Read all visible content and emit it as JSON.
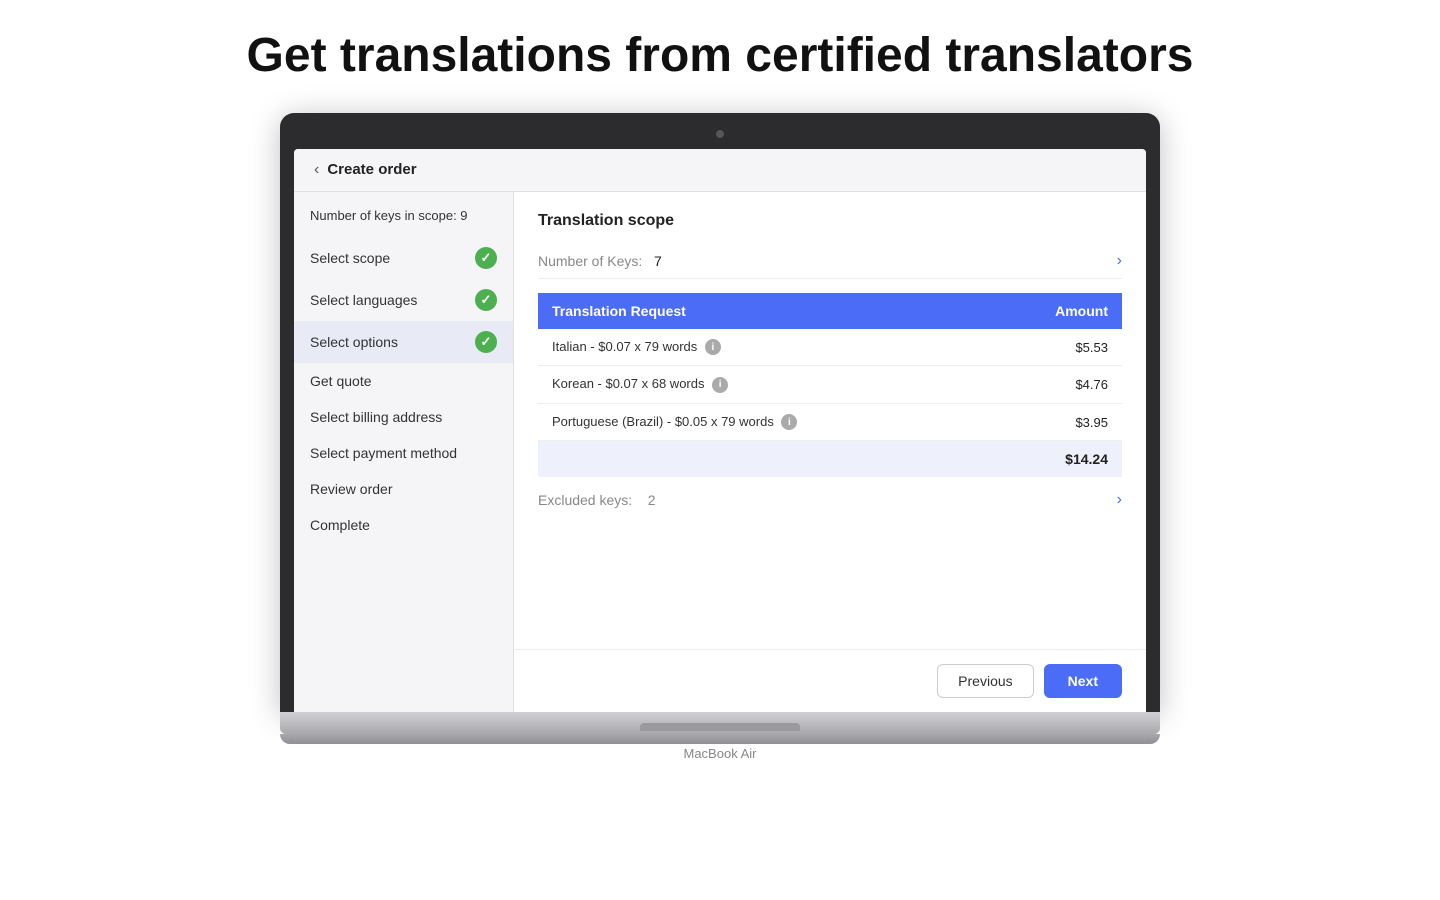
{
  "page": {
    "headline": "Get translations from certified translators"
  },
  "header": {
    "back_label": "‹",
    "title": "Create order"
  },
  "sidebar": {
    "keys_info": "Number of keys in scope: 9",
    "items": [
      {
        "label": "Select scope",
        "checked": true,
        "active": false
      },
      {
        "label": "Select languages",
        "checked": true,
        "active": false
      },
      {
        "label": "Select options",
        "checked": true,
        "active": true
      },
      {
        "label": "Get quote",
        "checked": false,
        "active": false
      },
      {
        "label": "Select billing address",
        "checked": false,
        "active": false
      },
      {
        "label": "Select payment method",
        "checked": false,
        "active": false
      },
      {
        "label": "Review order",
        "checked": false,
        "active": false
      },
      {
        "label": "Complete",
        "checked": false,
        "active": false
      }
    ]
  },
  "main": {
    "section_title": "Translation scope",
    "number_of_keys_label": "Number of Keys:",
    "number_of_keys_value": "7",
    "table": {
      "col_request": "Translation Request",
      "col_amount": "Amount",
      "rows": [
        {
          "request": "Italian - $0.07 x 79 words",
          "amount": "$5.53"
        },
        {
          "request": "Korean - $0.07 x 68 words",
          "amount": "$4.76"
        },
        {
          "request": "Portuguese (Brazil) - $0.05 x 79 words",
          "amount": "$3.95"
        }
      ],
      "total": "$14.24"
    },
    "excluded_keys_label": "Excluded keys:",
    "excluded_keys_value": "2"
  },
  "footer": {
    "previous_label": "Previous",
    "next_label": "Next"
  },
  "macbook": {
    "label": "MacBook Air"
  }
}
